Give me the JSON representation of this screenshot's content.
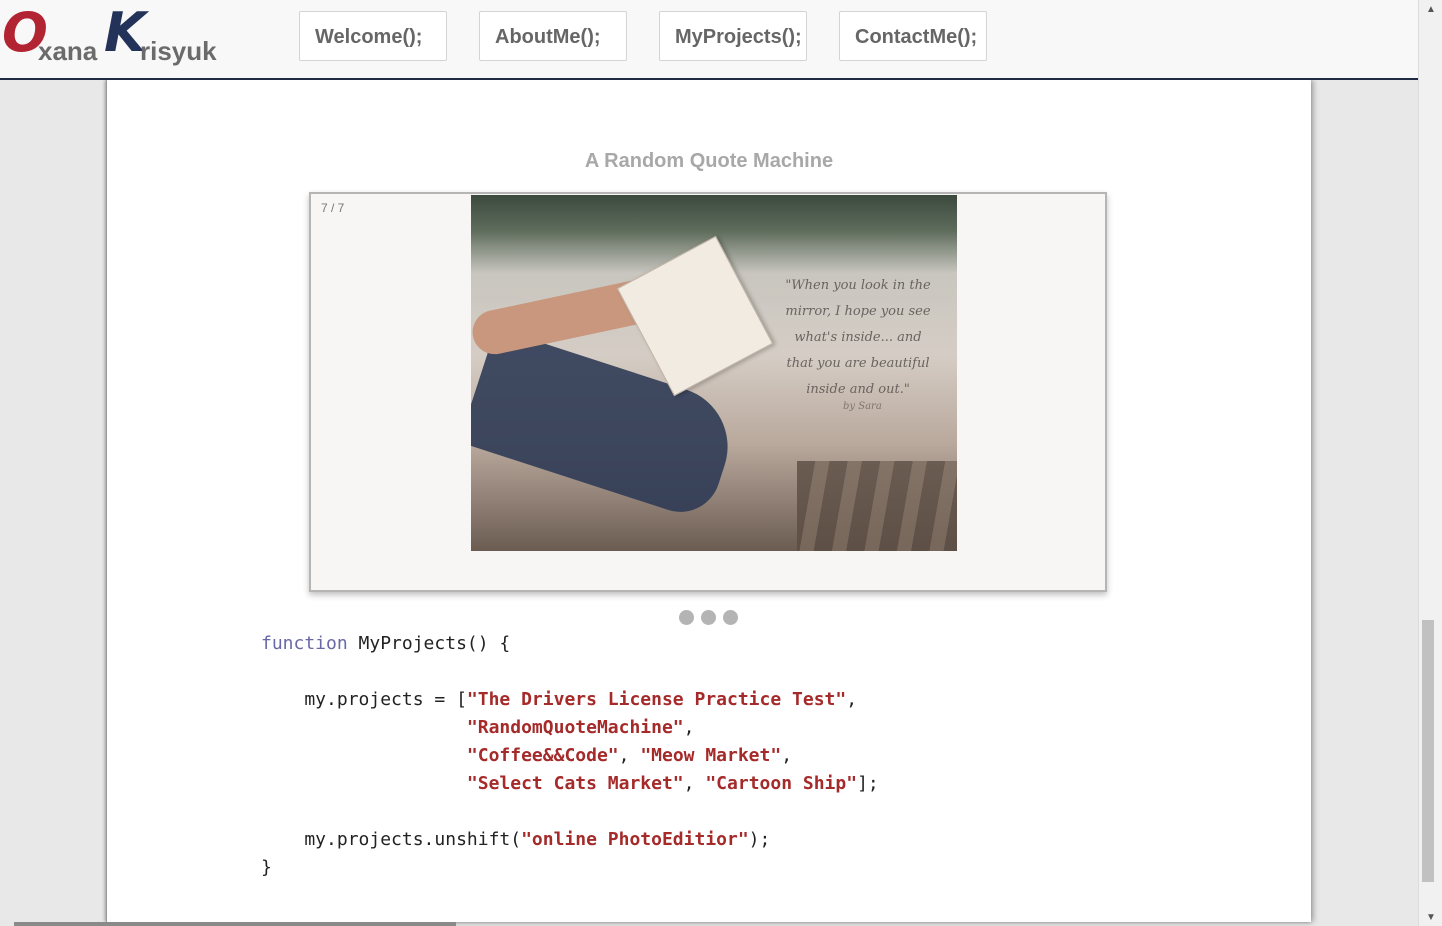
{
  "logo": {
    "first_initial": "O",
    "first_rest": "xana",
    "last_initial": "K",
    "last_rest": "risyuk"
  },
  "nav": {
    "welcome": "Welcome();",
    "about": "AboutMe();",
    "projects": "MyProjects();",
    "contact": "ContactMe();"
  },
  "project": {
    "title": "A Random Quote Machine",
    "counter": "7 / 7",
    "quote": "\"When you look in the mirror, I hope you see what's inside... and that you are beautiful inside and out.\"",
    "byline": "by Sara"
  },
  "code": {
    "keyword": "function",
    "fn_name": " MyProjects() {",
    "line2_prefix": "    my.projects = [",
    "p1": "\"The Drivers License Practice Test\"",
    "p2": "\"RandomQuoteMachine\"",
    "p3": "\"Coffee&&Code\"",
    "p4": "\"Meow Market\"",
    "p5": "\"Select Cats Market\"",
    "p6": "\"Cartoon Ship\"",
    "unshift_prefix": "    my.projects.unshift(",
    "p7": "\"online PhotoEditior\"",
    "unshift_suffix": ");",
    "closing": "}"
  },
  "scrollbar": {
    "up": "▲",
    "down": "▼"
  },
  "colors": {
    "accent_red": "#b32433",
    "accent_navy": "#233258",
    "string": "#a52a2a",
    "keyword": "#6868a8"
  }
}
